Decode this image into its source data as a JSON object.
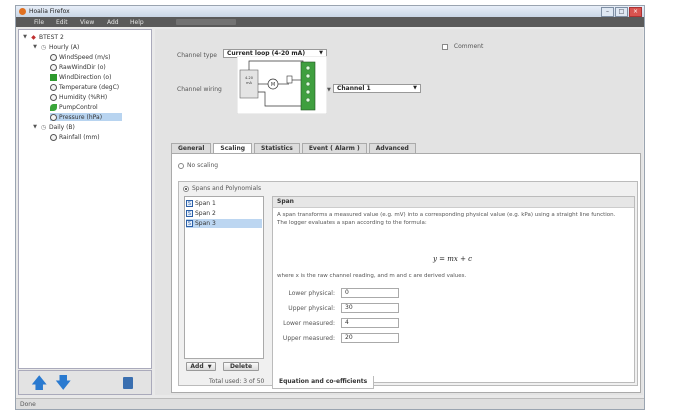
{
  "window": {
    "title": "Hoalia Firefox"
  },
  "menu": {
    "items": [
      "File",
      "Edit",
      "View",
      "Add",
      "Help"
    ]
  },
  "sidebar": {
    "root": "BTEST 2",
    "groups": [
      {
        "label": "Hourly (A)",
        "children": [
          "WindSpeed (m/s)",
          "RawWindDir (o)",
          "WindDirection (o)",
          "Temperature (degC)",
          "Humidity (%RH)",
          "PumpControl",
          "Pressure (hPa)"
        ]
      },
      {
        "label": "Daily (B)",
        "children": [
          "Rainfall (mm)"
        ]
      }
    ]
  },
  "channel": {
    "type_label": "Channel type",
    "type_value": "Current loop (4-20 mA)",
    "wiring_label": "Channel wiring",
    "wiring_value": "Channel 1",
    "comment_label": "Comment",
    "device_label": "4-20 mA loop"
  },
  "tabs": [
    "General",
    "Scaling",
    "Statistics",
    "Event ( Alarm )",
    "Advanced"
  ],
  "scaling": {
    "no_scaling": "No scaling",
    "spans_label": "Spans and Polynomials",
    "spans": [
      "Span 1",
      "Span 2",
      "Span 3"
    ],
    "add_button": "Add",
    "delete_button": "Delete",
    "total_used": "Total used: 3 of 50",
    "detail_header": "Span",
    "description": "A span transforms a measured value (e.g. mV) into a corresponding physical value (e.g. kPa) using a straight line function. The logger evaluates a span according to the formula:",
    "formula": "y = mx + c",
    "note": "where x is the raw channel reading, and m and c are derived values.",
    "fields": [
      {
        "label": "Lower physical:",
        "value": "0"
      },
      {
        "label": "Upper physical:",
        "value": "30"
      },
      {
        "label": "Lower measured:",
        "value": "4"
      },
      {
        "label": "Upper measured:",
        "value": "20"
      }
    ],
    "subtab": "Equation and co-efficients"
  },
  "status": {
    "text": "Done"
  }
}
